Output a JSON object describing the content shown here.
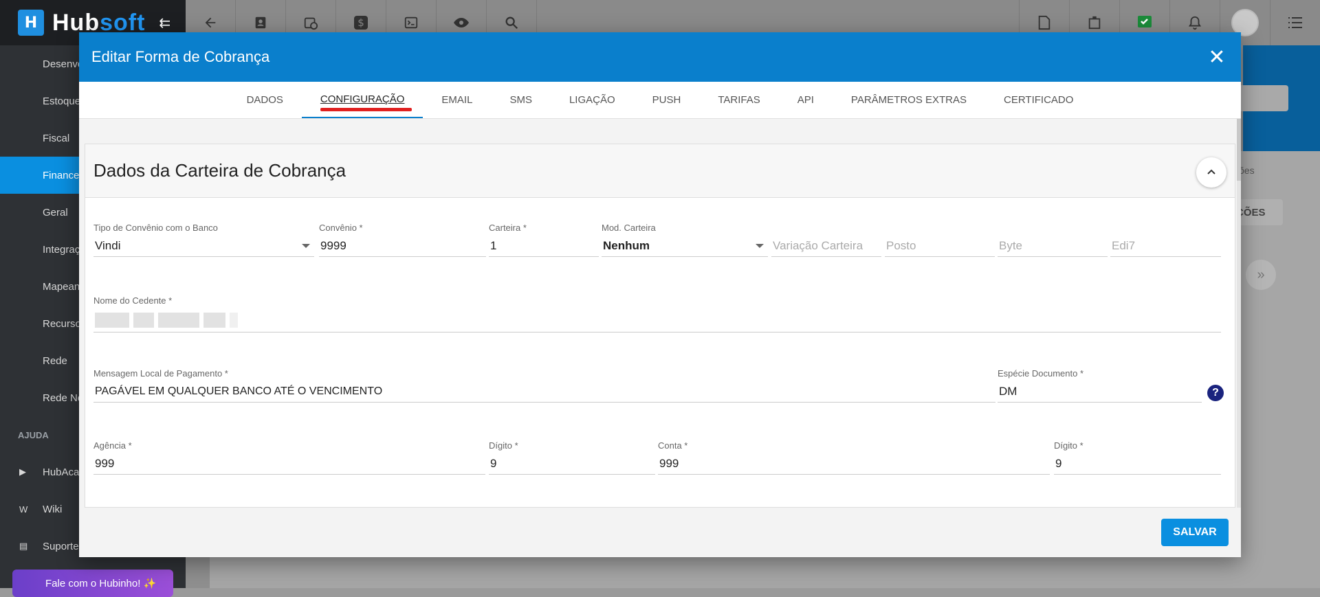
{
  "brand": {
    "name_a": "Hub",
    "name_b": "soft"
  },
  "sidebar": {
    "items": [
      {
        "label": "Desenvo",
        "icon": "code-icon"
      },
      {
        "label": "Estoque",
        "icon": "box-icon"
      },
      {
        "label": "Fiscal",
        "icon": "receipt-icon"
      },
      {
        "label": "Finance",
        "icon": "money-icon"
      },
      {
        "label": "Geral",
        "icon": "gear-icon"
      },
      {
        "label": "Integraç",
        "icon": "plug-icon"
      },
      {
        "label": "Mapean",
        "icon": "map-icon"
      },
      {
        "label": "Recurso",
        "icon": "people-icon"
      },
      {
        "label": "Rede",
        "icon": "network-icon"
      },
      {
        "label": "Rede Ne",
        "icon": "network-icon"
      }
    ],
    "help_heading": "AJUDA",
    "help_items": [
      {
        "label": "HubAca",
        "icon": "youtube-icon"
      },
      {
        "label": "Wiki",
        "icon": "wikipedia-icon"
      },
      {
        "label": "Suporte",
        "icon": "chat-icon"
      }
    ],
    "hubinho": "Fale com o Hubinho! ✨"
  },
  "background": {
    "tab_label": "ões",
    "button_label": "ÇÕES"
  },
  "modal": {
    "title": "Editar Forma de Cobrança",
    "tabs": [
      "DADOS",
      "CONFIGURAÇÃO",
      "EMAIL",
      "SMS",
      "LIGAÇÃO",
      "PUSH",
      "TARIFAS",
      "API",
      "PARÂMETROS EXTRAS",
      "CERTIFICADO"
    ],
    "active_tab": "CONFIGURAÇÃO",
    "section_title": "Dados da Carteira de Cobrança",
    "fields": {
      "tipo_convenio": {
        "label": "Tipo de Convênio com o Banco",
        "value": "Vindi"
      },
      "convenio": {
        "label": "Convênio *",
        "value": "9999"
      },
      "carteira": {
        "label": "Carteira *",
        "value": "1"
      },
      "mod_carteira": {
        "label": "Mod. Carteira",
        "value": "Nenhum"
      },
      "variacao": {
        "placeholder": "Variação Carteira"
      },
      "posto": {
        "placeholder": "Posto"
      },
      "byte": {
        "placeholder": "Byte"
      },
      "edi7": {
        "placeholder": "Edi7"
      },
      "nome_cedente": {
        "label": "Nome do Cedente *"
      },
      "mensagem": {
        "label": "Mensagem Local de Pagamento *",
        "value": "PAGÁVEL EM QUALQUER BANCO ATÉ O VENCIMENTO"
      },
      "especie": {
        "label": "Espécie Documento *",
        "value": "DM"
      },
      "agencia": {
        "label": "Agência *",
        "value": "999"
      },
      "digito1": {
        "label": "Dígito *",
        "value": "9"
      },
      "conta": {
        "label": "Conta *",
        "value": "999"
      },
      "digito2": {
        "label": "Dígito *",
        "value": "9"
      }
    },
    "save_label": "SALVAR"
  },
  "colors": {
    "primary": "#0a7fcc",
    "active_tab_marker": "#e02020",
    "save": "#0a8fe0"
  }
}
